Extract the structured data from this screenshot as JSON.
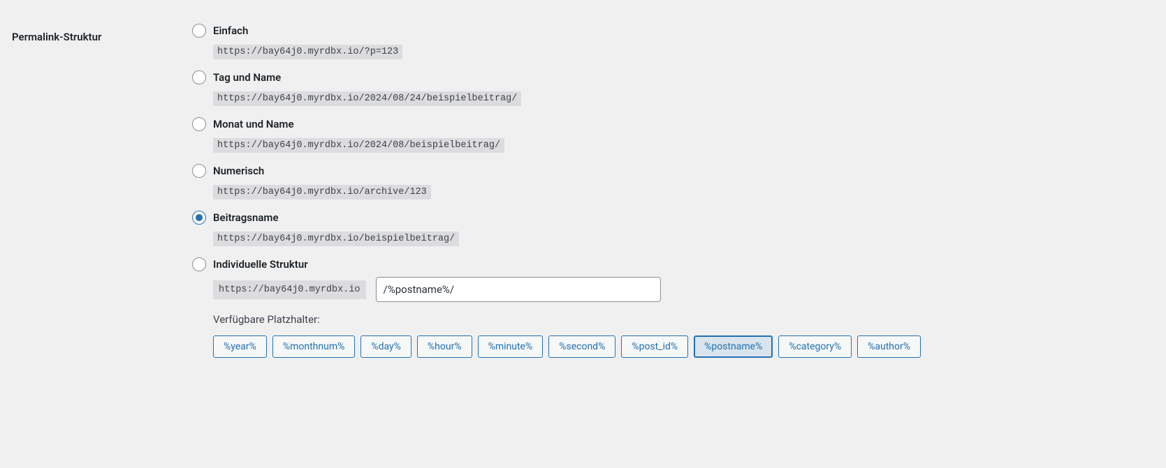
{
  "section_label": "Permalink-Struktur",
  "options": {
    "simple": {
      "label": "Einfach",
      "example": "https://bay64j0.myrdbx.io/?p=123"
    },
    "day_name": {
      "label": "Tag und Name",
      "example": "https://bay64j0.myrdbx.io/2024/08/24/beispielbeitrag/"
    },
    "month_name": {
      "label": "Monat und Name",
      "example": "https://bay64j0.myrdbx.io/2024/08/beispielbeitrag/"
    },
    "numeric": {
      "label": "Numerisch",
      "example": "https://bay64j0.myrdbx.io/archive/123"
    },
    "postname": {
      "label": "Beitragsname",
      "example": "https://bay64j0.myrdbx.io/beispielbeitrag/"
    },
    "custom": {
      "label": "Individuelle Struktur",
      "base": "https://bay64j0.myrdbx.io",
      "value": "/%postname%/"
    }
  },
  "available_label": "Verfügbare Platzhalter:",
  "tags": [
    {
      "text": "%year%",
      "active": false
    },
    {
      "text": "%monthnum%",
      "active": false
    },
    {
      "text": "%day%",
      "active": false
    },
    {
      "text": "%hour%",
      "active": false
    },
    {
      "text": "%minute%",
      "active": false
    },
    {
      "text": "%second%",
      "active": false
    },
    {
      "text": "%post_id%",
      "active": false
    },
    {
      "text": "%postname%",
      "active": true
    },
    {
      "text": "%category%",
      "active": false
    },
    {
      "text": "%author%",
      "active": false
    }
  ]
}
